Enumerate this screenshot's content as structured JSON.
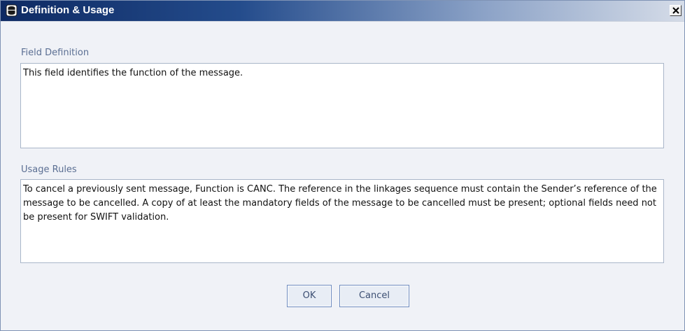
{
  "window": {
    "title": "Definition & Usage",
    "icon": "database-icon",
    "close_icon": "close-icon"
  },
  "field_definition": {
    "label": "Field Definition",
    "text": "This field identifies the function of the message."
  },
  "usage_rules": {
    "label": "Usage Rules",
    "text": "To cancel a previously sent message, Function is CANC. The reference in the linkages sequence must contain the Sender’s reference of the message to be cancelled. A copy of at least the mandatory fields of the message to be cancelled must be present; optional fields need not be present for SWIFT validation."
  },
  "buttons": {
    "ok": "OK",
    "cancel": "Cancel"
  },
  "colors": {
    "title_gradient_start": "#0e2a63",
    "label_text": "#5b6f93",
    "button_border": "#6f8cbf"
  }
}
